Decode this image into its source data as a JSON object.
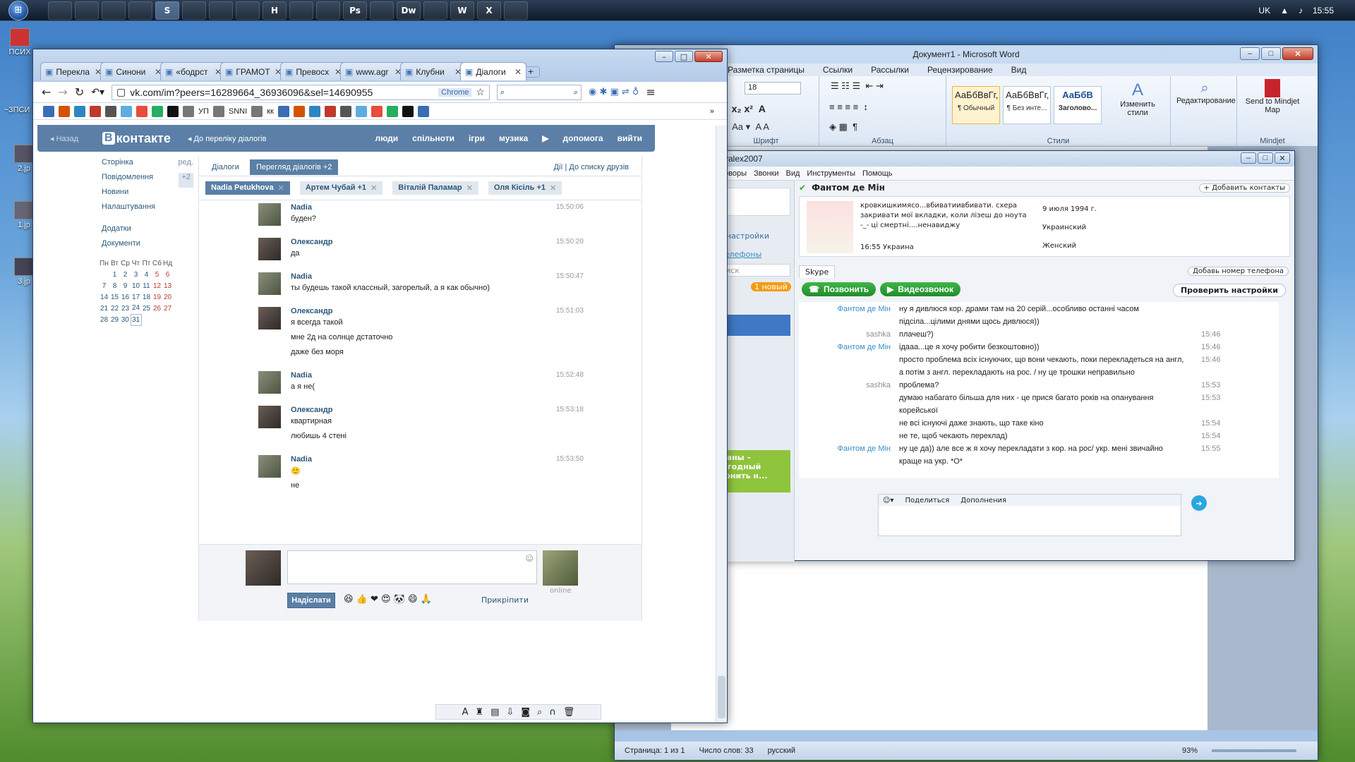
{
  "taskbar": {
    "icons": [
      "",
      "",
      "",
      "",
      "S",
      "",
      "",
      "",
      "H",
      "",
      "",
      "Ps",
      "",
      "Dw",
      "",
      "W",
      "X",
      ""
    ],
    "active_index": 4,
    "lang": "UK",
    "time": "15:55"
  },
  "desktop": {
    "icons": [
      {
        "label": "ПСИХ"
      },
      {
        "label": "~ЗПСИ"
      },
      {
        "label": "2.jp"
      },
      {
        "label": "1.jp"
      },
      {
        "label": "3.jp"
      }
    ]
  },
  "word": {
    "title": "Документ1 - Microsoft Word",
    "tabs": [
      "Разметка страницы",
      "Ссылки",
      "Рассылки",
      "Рецензирование",
      "Вид"
    ],
    "font_size": "18",
    "groups": {
      "font": "Шрифт",
      "paragraph": "Абзац",
      "styles": "Стили",
      "mindjet": "Mindjet"
    },
    "styles": [
      {
        "sample": "АаБбВвГг,",
        "name": "¶ Обычный"
      },
      {
        "sample": "АаБбВвГг,",
        "name": "¶ Без инте..."
      },
      {
        "sample": "АаБбВ",
        "name": "Заголово..."
      }
    ],
    "change_styles": "Изменить стили",
    "editing": "Редактирование",
    "send_mindjet": "Send to Mindjet Map",
    "status": {
      "page": "Страница: 1 из 1",
      "words": "Число слов: 33",
      "lang": "русский",
      "zoom": "93%"
    }
  },
  "skype": {
    "title": "yalex2007",
    "menu": [
      "оворы",
      "Звонки",
      "Вид",
      "Инструменты",
      "Помощь"
    ],
    "left": {
      "settings": "ые настройки",
      "phones": "е телефоны",
      "search": "Поиск",
      "new_badge": "1 новый",
      "promo": "планы – выгодный звонить н..."
    },
    "contact": {
      "name": "Фантом де Мін",
      "add_contacts": "+ Добавить контакты",
      "mood": "кровкишкимясо...вбиватиивбивати. схера закривати мої вкладки, коли лізеш до ноута -_- ці смертні....ненавиджу",
      "birthday": "9 июля 1994 г.",
      "country": "Украинский",
      "gender": "Женский",
      "localtime": "16:55 Украина"
    },
    "tab": "Skype",
    "add_phone": "Добавь номер телефона",
    "call": "Позвонить",
    "video": "Видеозвонок",
    "check": "Проверить настройки",
    "chat": [
      {
        "name": "Фантом де Мін",
        "friend": true,
        "lines": [
          "ну я дивлюся кор. драми там на 20 серій...особливо останні часом",
          "підсіла...цілими днями щось дивлюся))"
        ],
        "time": ""
      },
      {
        "name": "sashka",
        "friend": false,
        "lines": [
          "плачеш?)"
        ],
        "time": "15:46"
      },
      {
        "name": "Фантом де Мін",
        "friend": true,
        "lines": [
          "ідааа...це я хочу робити безкоштовно))"
        ],
        "time": "15:46"
      },
      {
        "name": "",
        "friend": true,
        "lines": [
          "просто проблема всіх існуючих, що вони чекають, поки перекладеться на англ,",
          "а потім з англ. перекладають на рос. / ну це трошки неправильно"
        ],
        "time": "15:46"
      },
      {
        "name": "sashka",
        "friend": false,
        "lines": [
          "проблема?"
        ],
        "time": "15:53"
      },
      {
        "name": "",
        "friend": false,
        "lines": [
          "думаю набагато більша для них - це прися багато років на опанування",
          "корейської"
        ],
        "time": "15:53"
      },
      {
        "name": "",
        "friend": false,
        "lines": [
          "не всі існуючі даже знають, що таке кіно"
        ],
        "time": "15:54"
      },
      {
        "name": "",
        "friend": false,
        "lines": [
          "не те, щоб чекають переклад)"
        ],
        "time": "15:54"
      },
      {
        "name": "Фантом де Мін",
        "friend": true,
        "lines": [
          "ну це да)) але все ж я хочу перекладати з кор. на рос/ укр. мені звичайно",
          "краще на укр. *O*"
        ],
        "time": "15:55"
      }
    ],
    "share": "Поделиться",
    "addons": "Дополнения"
  },
  "chrome": {
    "tabs": [
      "Перекла",
      "Синони",
      "«бодрст",
      "ГРАМОТ",
      "Превосх",
      "www.agr",
      "Клубни",
      "Діалоги"
    ],
    "active_tab": 7,
    "url": "vk.com/im?peers=16289664_36936096&sel=14690955",
    "chrome_label": "Chrome",
    "bookmarks": [
      "УП",
      "SNNI",
      "кк"
    ]
  },
  "vk": {
    "back": "Назад",
    "logo_b": "В",
    "logo": "контакте",
    "to_list": "До переліку діалогів",
    "nav": [
      "люди",
      "спільноти",
      "ігри",
      "музика",
      "допомога",
      "вийти"
    ],
    "side": [
      {
        "label": "Сторінка",
        "extra": "ред."
      },
      {
        "label": "Повідомлення",
        "extra": "+2"
      },
      {
        "label": "Новини",
        "extra": ""
      },
      {
        "label": "Налаштування",
        "extra": ""
      },
      {
        "label": "Додатки",
        "extra": ""
      },
      {
        "label": "Документи",
        "extra": ""
      }
    ],
    "cal_head": [
      "Пн",
      "Вт",
      "Ср",
      "Чт",
      "Пт",
      "Сб",
      "Нд"
    ],
    "cal_rows": [
      [
        "",
        "1",
        "2",
        "3",
        "4",
        "5",
        "6"
      ],
      [
        "7",
        "8",
        "9",
        "10",
        "11",
        "12",
        "13"
      ],
      [
        "14",
        "15",
        "16",
        "17",
        "18",
        "19",
        "20"
      ],
      [
        "21",
        "22",
        "23",
        "24",
        "25",
        "26",
        "27"
      ],
      [
        "28",
        "29",
        "30",
        "31",
        "",
        "",
        ""
      ]
    ],
    "tab_dialogs": "Діалоги",
    "tab_view": "Перегляд діалогів  +2",
    "actions": "Дії",
    "friends": "До списку друзів",
    "peers": [
      "Nadia Petukhova",
      "Артем Чубай +1",
      "Віталій Паламар",
      "Оля Кісіль +1"
    ],
    "messages": [
      {
        "who": "Nadia",
        "time": "15:50:06",
        "lines": [
          "буден?"
        ]
      },
      {
        "who": "Олександр",
        "time": "15:50:20",
        "lines": [
          "да"
        ]
      },
      {
        "who": "Nadia",
        "time": "15:50:47",
        "lines": [
          "ты будешь такой классный, загорелый, а я как обычно)"
        ]
      },
      {
        "who": "Олександр",
        "time": "15:51:03",
        "lines": [
          "я всегда такой",
          "мне 2д на солнце дстаточно",
          "даже без моря"
        ]
      },
      {
        "who": "Nadia",
        "time": "15:52:48",
        "lines": [
          "а я не("
        ]
      },
      {
        "who": "Олександр",
        "time": "15:53:18",
        "lines": [
          "квартирная",
          "любишь 4 стені"
        ]
      },
      {
        "who": "Nadia",
        "time": "15:53:50",
        "lines": [
          "🙂",
          "не"
        ]
      }
    ],
    "send": "Надіслати",
    "attach": "Прикріпити",
    "online": "online"
  }
}
